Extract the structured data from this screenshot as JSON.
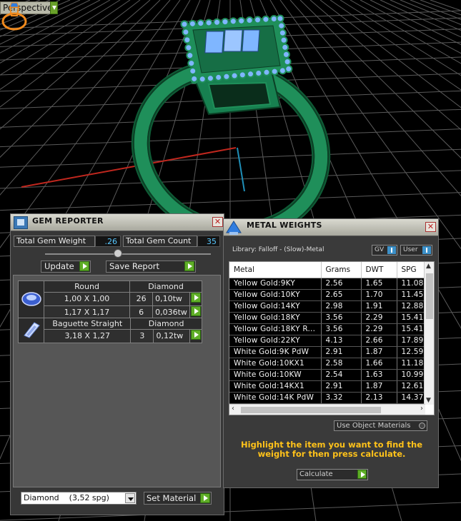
{
  "viewport": {
    "view_label": "Perspective"
  },
  "gem_reporter": {
    "title": "GEM REPORTER",
    "total_weight_label": "Total Gem Weight",
    "total_weight_value": ".26",
    "total_count_label": "Total Gem Count",
    "total_count_value": "35",
    "update_label": "Update",
    "save_report_label": "Save Report",
    "groups": [
      {
        "shape": "Round",
        "material": "Diamond",
        "icon": "round-gem-icon",
        "rows": [
          {
            "size": "1,00 X 1,00",
            "count": "26",
            "weight": "0,10tw"
          },
          {
            "size": "1,17 X 1,17",
            "count": "6",
            "weight": "0,036tw"
          }
        ]
      },
      {
        "shape": "Baguette Straight",
        "material": "Diamond",
        "icon": "baguette-gem-icon",
        "rows": [
          {
            "size": "3,18 X 1,27",
            "count": "3",
            "weight": "0,12tw"
          }
        ]
      }
    ],
    "material_select": "Diamond    (3,52 spg)",
    "set_material_label": "Set Material"
  },
  "metal_weights": {
    "title": "METAL WEIGHTS",
    "library": "Library: Falloff - (Slow)-Metal",
    "toggle_gv": "GV",
    "toggle_user": "User",
    "columns": [
      "Metal",
      "Grams",
      "DWT",
      "SPG"
    ],
    "rows": [
      [
        "Yellow Gold:9KY",
        "2.56",
        "1.65",
        "11.08"
      ],
      [
        "Yellow Gold:10KY",
        "2.65",
        "1.70",
        "11.45"
      ],
      [
        "Yellow Gold:14KY",
        "2.98",
        "1.91",
        "12.88"
      ],
      [
        "Yellow Gold:18KY",
        "3.56",
        "2.29",
        "15.41"
      ],
      [
        "Yellow Gold:18KY R...",
        "3.56",
        "2.29",
        "15.41"
      ],
      [
        "Yellow Gold:22KY",
        "4.13",
        "2.66",
        "17.89"
      ],
      [
        "White Gold:9K PdW",
        "2.91",
        "1.87",
        "12.59"
      ],
      [
        "White Gold:10KX1",
        "2.58",
        "1.66",
        "11.18"
      ],
      [
        "White Gold:10KW",
        "2.54",
        "1.63",
        "10.99"
      ],
      [
        "White Gold:14KX1",
        "2.91",
        "1.87",
        "12.61"
      ],
      [
        "White Gold:14K PdW",
        "3.32",
        "2.13",
        "14.37"
      ]
    ],
    "use_object_materials": "Use Object Materials",
    "hint": "Highlight the item you want to find the weight for then press calculate.",
    "calculate_label": "Calculate"
  },
  "colors": {
    "ring_green": "#1f8f5a",
    "stone_blue": "#7fb6ff",
    "hint_yellow": "#ffc21a",
    "value_cyan": "#59c8ff"
  }
}
